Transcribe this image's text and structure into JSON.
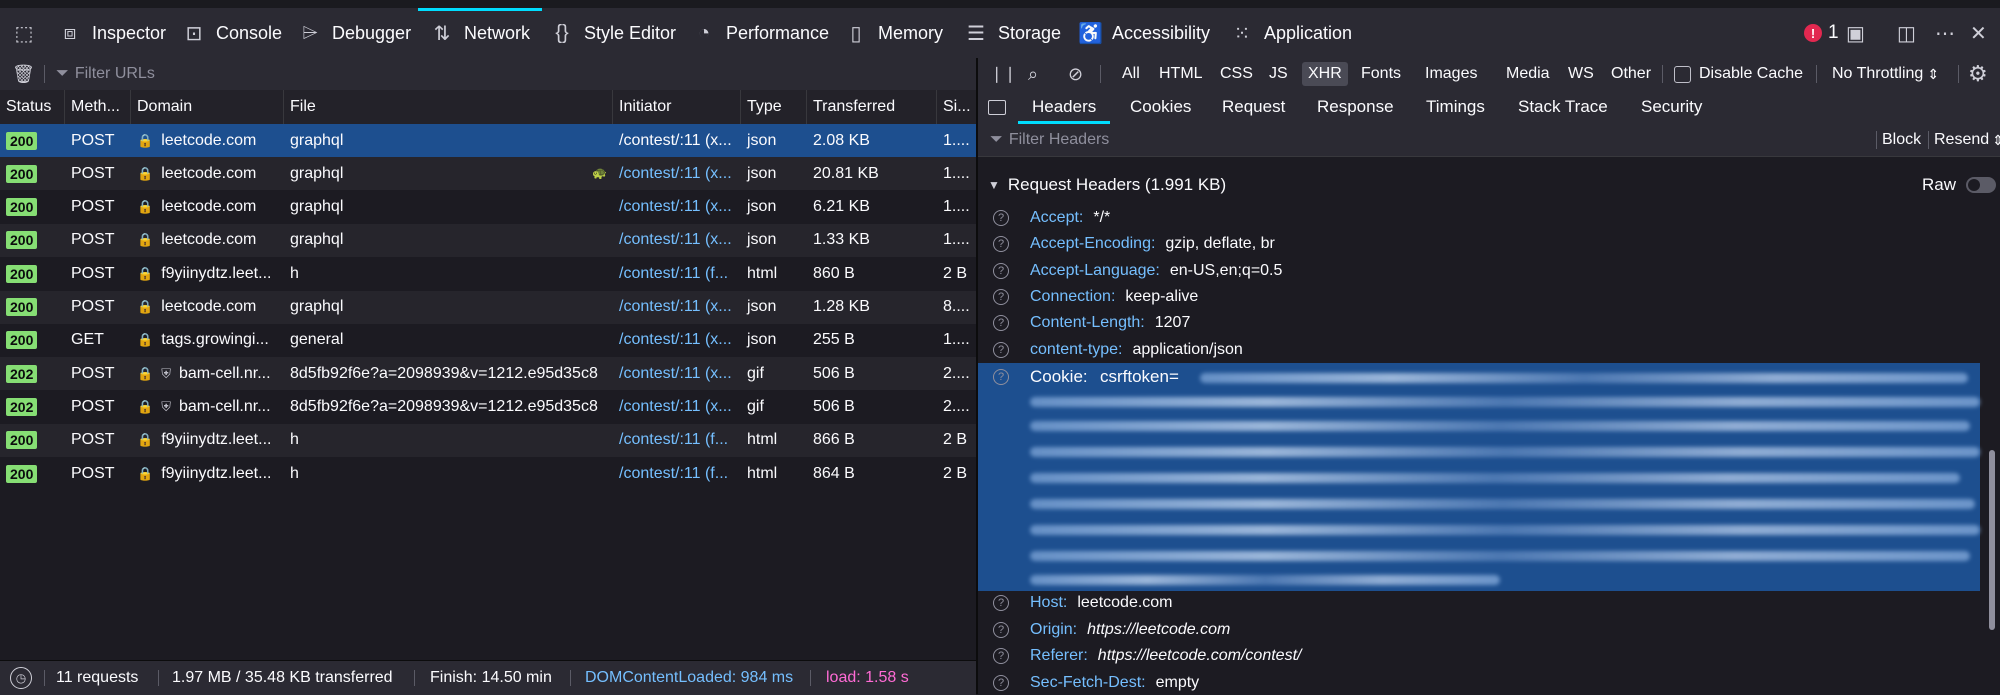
{
  "toolbox": {
    "tabs": [
      {
        "label": "Inspector",
        "icon": "inspector-icon"
      },
      {
        "label": "Console",
        "icon": "console-icon"
      },
      {
        "label": "Debugger",
        "icon": "debugger-icon"
      },
      {
        "label": "Network",
        "icon": "network-icon",
        "active": true
      },
      {
        "label": "Style Editor",
        "icon": "style-editor-icon"
      },
      {
        "label": "Performance",
        "icon": "performance-icon"
      },
      {
        "label": "Memory",
        "icon": "memory-icon"
      },
      {
        "label": "Storage",
        "icon": "storage-icon"
      },
      {
        "label": "Accessibility",
        "icon": "accessibility-icon"
      },
      {
        "label": "Application",
        "icon": "application-icon"
      }
    ],
    "error_count": "1"
  },
  "filterbar": {
    "placeholder": "Filter URLs",
    "types": [
      "All",
      "HTML",
      "CSS",
      "JS",
      "XHR",
      "Fonts",
      "Images",
      "Media",
      "WS",
      "Other"
    ],
    "active_type": "XHR",
    "disable_cache_label": "Disable Cache",
    "throttling_label": "No Throttling",
    "throttling_arrow": "⇕"
  },
  "columns": [
    "Status",
    "Meth...",
    "Domain",
    "File",
    "Initiator",
    "Type",
    "Transferred",
    "Si..."
  ],
  "requests": [
    {
      "status": "200",
      "method": "POST",
      "domain": "leetcode.com",
      "file": "graphql",
      "initiator": "/contest/:11 (x...",
      "type": "json",
      "transferred": "2.08 KB",
      "size": "1...."
    },
    {
      "status": "200",
      "method": "POST",
      "domain": "leetcode.com",
      "file": "graphql",
      "initiator": "/contest/:11 (x...",
      "type": "json",
      "transferred": "20.81 KB",
      "size": "1...."
    },
    {
      "status": "200",
      "method": "POST",
      "domain": "leetcode.com",
      "file": "graphql",
      "initiator": "/contest/:11 (x...",
      "type": "json",
      "transferred": "6.21 KB",
      "size": "1...."
    },
    {
      "status": "200",
      "method": "POST",
      "domain": "leetcode.com",
      "file": "graphql",
      "initiator": "/contest/:11 (x...",
      "type": "json",
      "transferred": "1.33 KB",
      "size": "1...."
    },
    {
      "status": "200",
      "method": "POST",
      "domain": "f9yiinydtz.leet...",
      "file": "h",
      "initiator": "/contest/:11 (f...",
      "type": "html",
      "transferred": "860 B",
      "size": "2 B"
    },
    {
      "status": "200",
      "method": "POST",
      "domain": "leetcode.com",
      "file": "graphql",
      "initiator": "/contest/:11 (x...",
      "type": "json",
      "transferred": "1.28 KB",
      "size": "8...."
    },
    {
      "status": "200",
      "method": "GET",
      "domain": "tags.growingi...",
      "file": "general",
      "initiator": "/contest/:11 (x...",
      "type": "json",
      "transferred": "255 B",
      "size": "1...."
    },
    {
      "status": "202",
      "method": "POST",
      "domain": "bam-cell.nr...",
      "file": "8d5fb92f6e?a=2098939&v=1212.e95d35c8",
      "initiator": "/contest/:11 (x...",
      "type": "gif",
      "transferred": "506 B",
      "size": "2...."
    },
    {
      "status": "202",
      "method": "POST",
      "domain": "bam-cell.nr...",
      "file": "8d5fb92f6e?a=2098939&v=1212.e95d35c8",
      "initiator": "/contest/:11 (x...",
      "type": "gif",
      "transferred": "506 B",
      "size": "2...."
    },
    {
      "status": "200",
      "method": "POST",
      "domain": "f9yiinydtz.leet...",
      "file": "h",
      "initiator": "/contest/:11 (f...",
      "type": "html",
      "transferred": "866 B",
      "size": "2 B"
    },
    {
      "status": "200",
      "method": "POST",
      "domain": "f9yiinydtz.leet...",
      "file": "h",
      "initiator": "/contest/:11 (f...",
      "type": "html",
      "transferred": "864 B",
      "size": "2 B"
    }
  ],
  "statusbar": {
    "requests": "11 requests",
    "transferred": "1.97 MB / 35.48 KB transferred",
    "finish": "Finish: 14.50 min",
    "dom_loaded": "DOMContentLoaded: 984 ms",
    "load": "load: 1.58 s"
  },
  "details": {
    "tabs": [
      "Headers",
      "Cookies",
      "Request",
      "Response",
      "Timings",
      "Stack Trace",
      "Security"
    ],
    "active_tab": "Headers",
    "filter_placeholder": "Filter Headers",
    "block_label": "Block",
    "resend_label": "Resend",
    "resend_arrow": "⇕",
    "section_title": "Request Headers (1.991 KB)",
    "raw_label": "Raw",
    "headers": [
      {
        "name": "Accept:",
        "value": "*/*"
      },
      {
        "name": "Accept-Encoding:",
        "value": "gzip, deflate, br"
      },
      {
        "name": "Accept-Language:",
        "value": "en-US,en;q=0.5"
      },
      {
        "name": "Connection:",
        "value": "keep-alive"
      },
      {
        "name": "Content-Length:",
        "value": "1207"
      },
      {
        "name": "content-type:",
        "value": "application/json"
      }
    ],
    "cookie": {
      "name": "Cookie:",
      "value": "csrftoken="
    },
    "headers_after": [
      {
        "name": "Host:",
        "value": "leetcode.com",
        "italic": false
      },
      {
        "name": "Origin:",
        "value": "https://leetcode.com",
        "italic": true
      },
      {
        "name": "Referer:",
        "value": "https://leetcode.com/contest/",
        "italic": true
      },
      {
        "name": "Sec-Fetch-Dest:",
        "value": "empty",
        "italic": false
      }
    ]
  },
  "colors": {
    "accent": "#00ddff",
    "selection": "#1d4f8f",
    "link": "#75bfff",
    "status_ok": "#86de74",
    "error": "#e22850",
    "load": "#ff6bd5"
  }
}
